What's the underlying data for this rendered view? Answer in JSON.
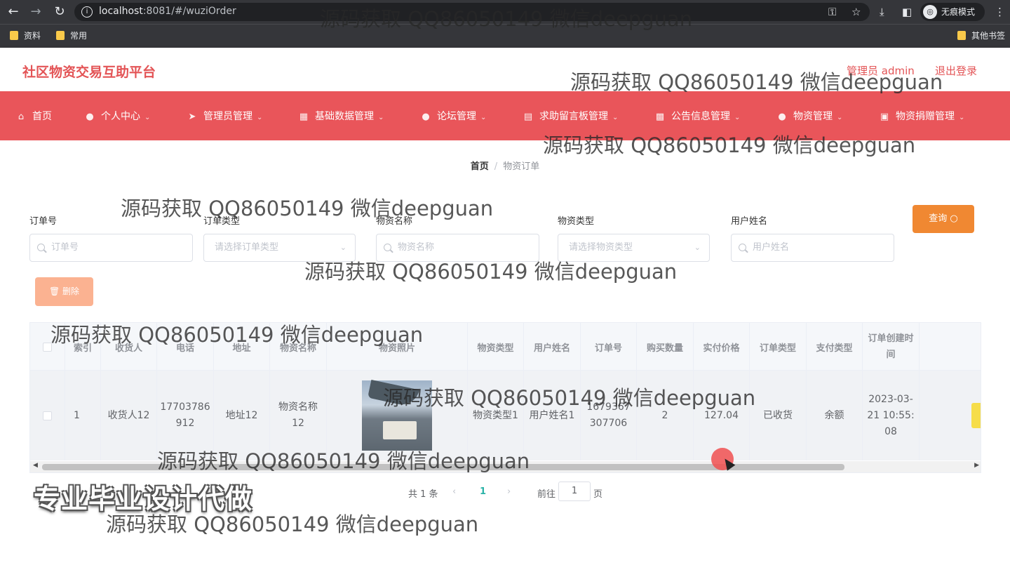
{
  "browser": {
    "url_host": "localhost",
    "url_rest": ":8081/#/wuziOrder",
    "incognito_label": "无痕模式",
    "bookmarks": [
      "资料",
      "常用"
    ],
    "other_bookmarks": "其他书签"
  },
  "header": {
    "site_title": "社区物资交易互助平台",
    "admin_label": "管理员 admin",
    "logout_label": "退出登录"
  },
  "nav": [
    {
      "label": "首页",
      "icon": "home-icon"
    },
    {
      "label": "个人中心",
      "icon": "user-icon"
    },
    {
      "label": "管理员管理",
      "icon": "send-icon"
    },
    {
      "label": "基础数据管理",
      "icon": "grid-icon"
    },
    {
      "label": "论坛管理",
      "icon": "person-icon"
    },
    {
      "label": "求助留言板管理",
      "icon": "clipboard-icon"
    },
    {
      "label": "公告信息管理",
      "icon": "briefcase-icon"
    },
    {
      "label": "物资管理",
      "icon": "pin-icon"
    },
    {
      "label": "物资捐赠管理",
      "icon": "picture-icon"
    }
  ],
  "breadcrumb": {
    "home": "首页",
    "separator": "/",
    "current": "物资订单"
  },
  "search": {
    "order_no_label": "订单号",
    "order_no_placeholder": "订单号",
    "order_type_label": "订单类型",
    "order_type_placeholder": "请选择订单类型",
    "goods_name_label": "物资名称",
    "goods_name_placeholder": "物资名称",
    "goods_type_label": "物资类型",
    "goods_type_placeholder": "请选择物资类型",
    "user_name_label": "用户姓名",
    "user_name_placeholder": "用户姓名",
    "query_label": "查询"
  },
  "actions": {
    "delete_label": "删除"
  },
  "table": {
    "columns": [
      "索引",
      "收货人",
      "电话",
      "地址",
      "物资名称",
      "物资照片",
      "物资类型",
      "用户姓名",
      "订单号",
      "购买数量",
      "实付价格",
      "订单类型",
      "支付类型",
      "订单创建时间"
    ],
    "rows": [
      {
        "index": "1",
        "receiver": "收货人12",
        "phone": "17703786912",
        "address": "地址12",
        "goods_name": "物资名称12",
        "goods_type": "物资类型1",
        "user_name": "用户姓名1",
        "order_no": "1679367307706",
        "quantity": "2",
        "price": "127.04",
        "order_type": "已收货",
        "pay_type": "余额",
        "created": "2023-03-21 10:55:08"
      }
    ]
  },
  "pager": {
    "total_text": "共 1 条",
    "current_page": "1",
    "goto_label": "前往",
    "goto_value": "1",
    "page_suffix": "页"
  },
  "overlay": {
    "ad_text": "专业毕业设计代做",
    "watermark": "源码获取 QQ86050149 微信deepguan"
  },
  "colors": {
    "brand": "#e9555a",
    "query_button": "#f08832",
    "delete_button": "#fbb291",
    "accent_text": "#e35456"
  }
}
